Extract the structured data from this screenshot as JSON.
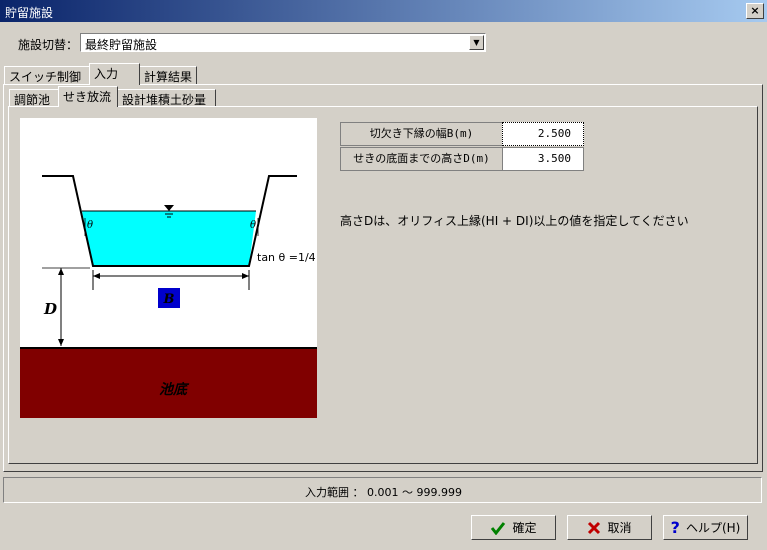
{
  "window": {
    "title": "貯留施設",
    "close": "×"
  },
  "facility": {
    "label": "施設切替：",
    "value": "最終貯留施設"
  },
  "tabs": [
    "スイッチ制御",
    "入力",
    "計算結果"
  ],
  "subtabs": [
    "調節池",
    "せき放流",
    "設計堆積土砂量"
  ],
  "diagram": {
    "theta_left": "θ",
    "theta_right": "θ",
    "tan": "tan θ =1/4",
    "D": "D",
    "B": "B",
    "bottom": "池底"
  },
  "params": [
    {
      "label": "切欠き下縁の幅B(m)",
      "value": "2.500"
    },
    {
      "label": "せきの底面までの高さD(m)",
      "value": "3.500"
    }
  ],
  "note": "高さDは、オリフィス上縁(HI + DI)以上の値を指定してください",
  "status": "入力範囲 ： 0.001 ～ 999.999",
  "buttons": {
    "ok": "確定",
    "cancel": "取消",
    "help": "ヘルプ(H)"
  },
  "colors": {
    "water": "#00ffff",
    "ground": "#800000",
    "b_box": "#0000cc"
  }
}
